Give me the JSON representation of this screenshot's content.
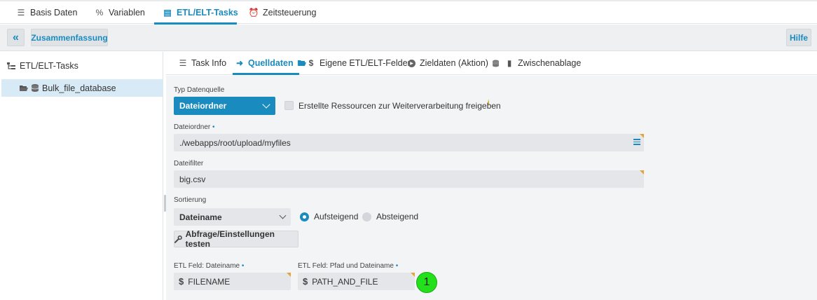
{
  "top_tabs": [
    {
      "label": "Basis Daten",
      "icon": "list-icon",
      "glyph": "☰"
    },
    {
      "label": "Variablen",
      "icon": "percent-icon",
      "glyph": "%"
    },
    {
      "label": "ETL/ELT-Tasks",
      "icon": "tasks-icon",
      "glyph": "▤"
    },
    {
      "label": "Zeitsteuerung",
      "icon": "alarm-clock-icon",
      "glyph": "⏰"
    }
  ],
  "toolbar": {
    "collapse_glyph": "«",
    "summary_label": "Zusammenfassung",
    "help_label": "Hilfe"
  },
  "tree": {
    "root_label": "ETL/ELT-Tasks",
    "item_label": "Bulk_file_database"
  },
  "sub_tabs": [
    {
      "label": "Task Info",
      "icon": "list-icon",
      "glyph": "☰"
    },
    {
      "label": "Quelldaten",
      "icon": "sign-in-icon",
      "glyph": "➜"
    },
    {
      "label": "Eigene ETL/ELT-Felder",
      "icon": "dollar-icon",
      "glyph": "$"
    },
    {
      "label": "Zieldaten (Aktion)",
      "icon": "play-circle-icon",
      "glyph": "▶"
    },
    {
      "label": "Zwischenablage",
      "icon": "clipboard-icon",
      "glyph": "▮"
    }
  ],
  "form": {
    "source_type": {
      "label": "Typ Datenquelle",
      "value": "Dateiordner"
    },
    "release_checkbox": {
      "label": "Erstellte Ressourcen zur Weiterverarbeitung freigeben",
      "checked": false,
      "info": "i"
    },
    "folder": {
      "label": "Dateiordner",
      "required_mark": "•",
      "value": "./webapps/root/upload/myfiles"
    },
    "filter": {
      "label": "Dateifilter",
      "value": "big.csv"
    },
    "sorting": {
      "label": "Sortierung",
      "value": "Dateiname",
      "ascending_label": "Aufsteigend",
      "descending_label": "Absteigend",
      "selected": "Aufsteigend"
    },
    "test_button": "Abfrage/Einstellungen testen",
    "etl_filename": {
      "label": "ETL Feld: Dateiname",
      "required_mark": "•",
      "value": "FILENAME"
    },
    "etl_path": {
      "label": "ETL Feld: Pfad und Dateiname",
      "required_mark": "•",
      "value": "PATH_AND_FILE"
    }
  },
  "annotation_badge": "1",
  "colors": {
    "accent": "#1a8bbf",
    "selected_tree_bg": "#d7eaf6",
    "field_bg": "#e4e6e9",
    "corner_marker": "#e8a23a",
    "badge": "#22e01a"
  }
}
